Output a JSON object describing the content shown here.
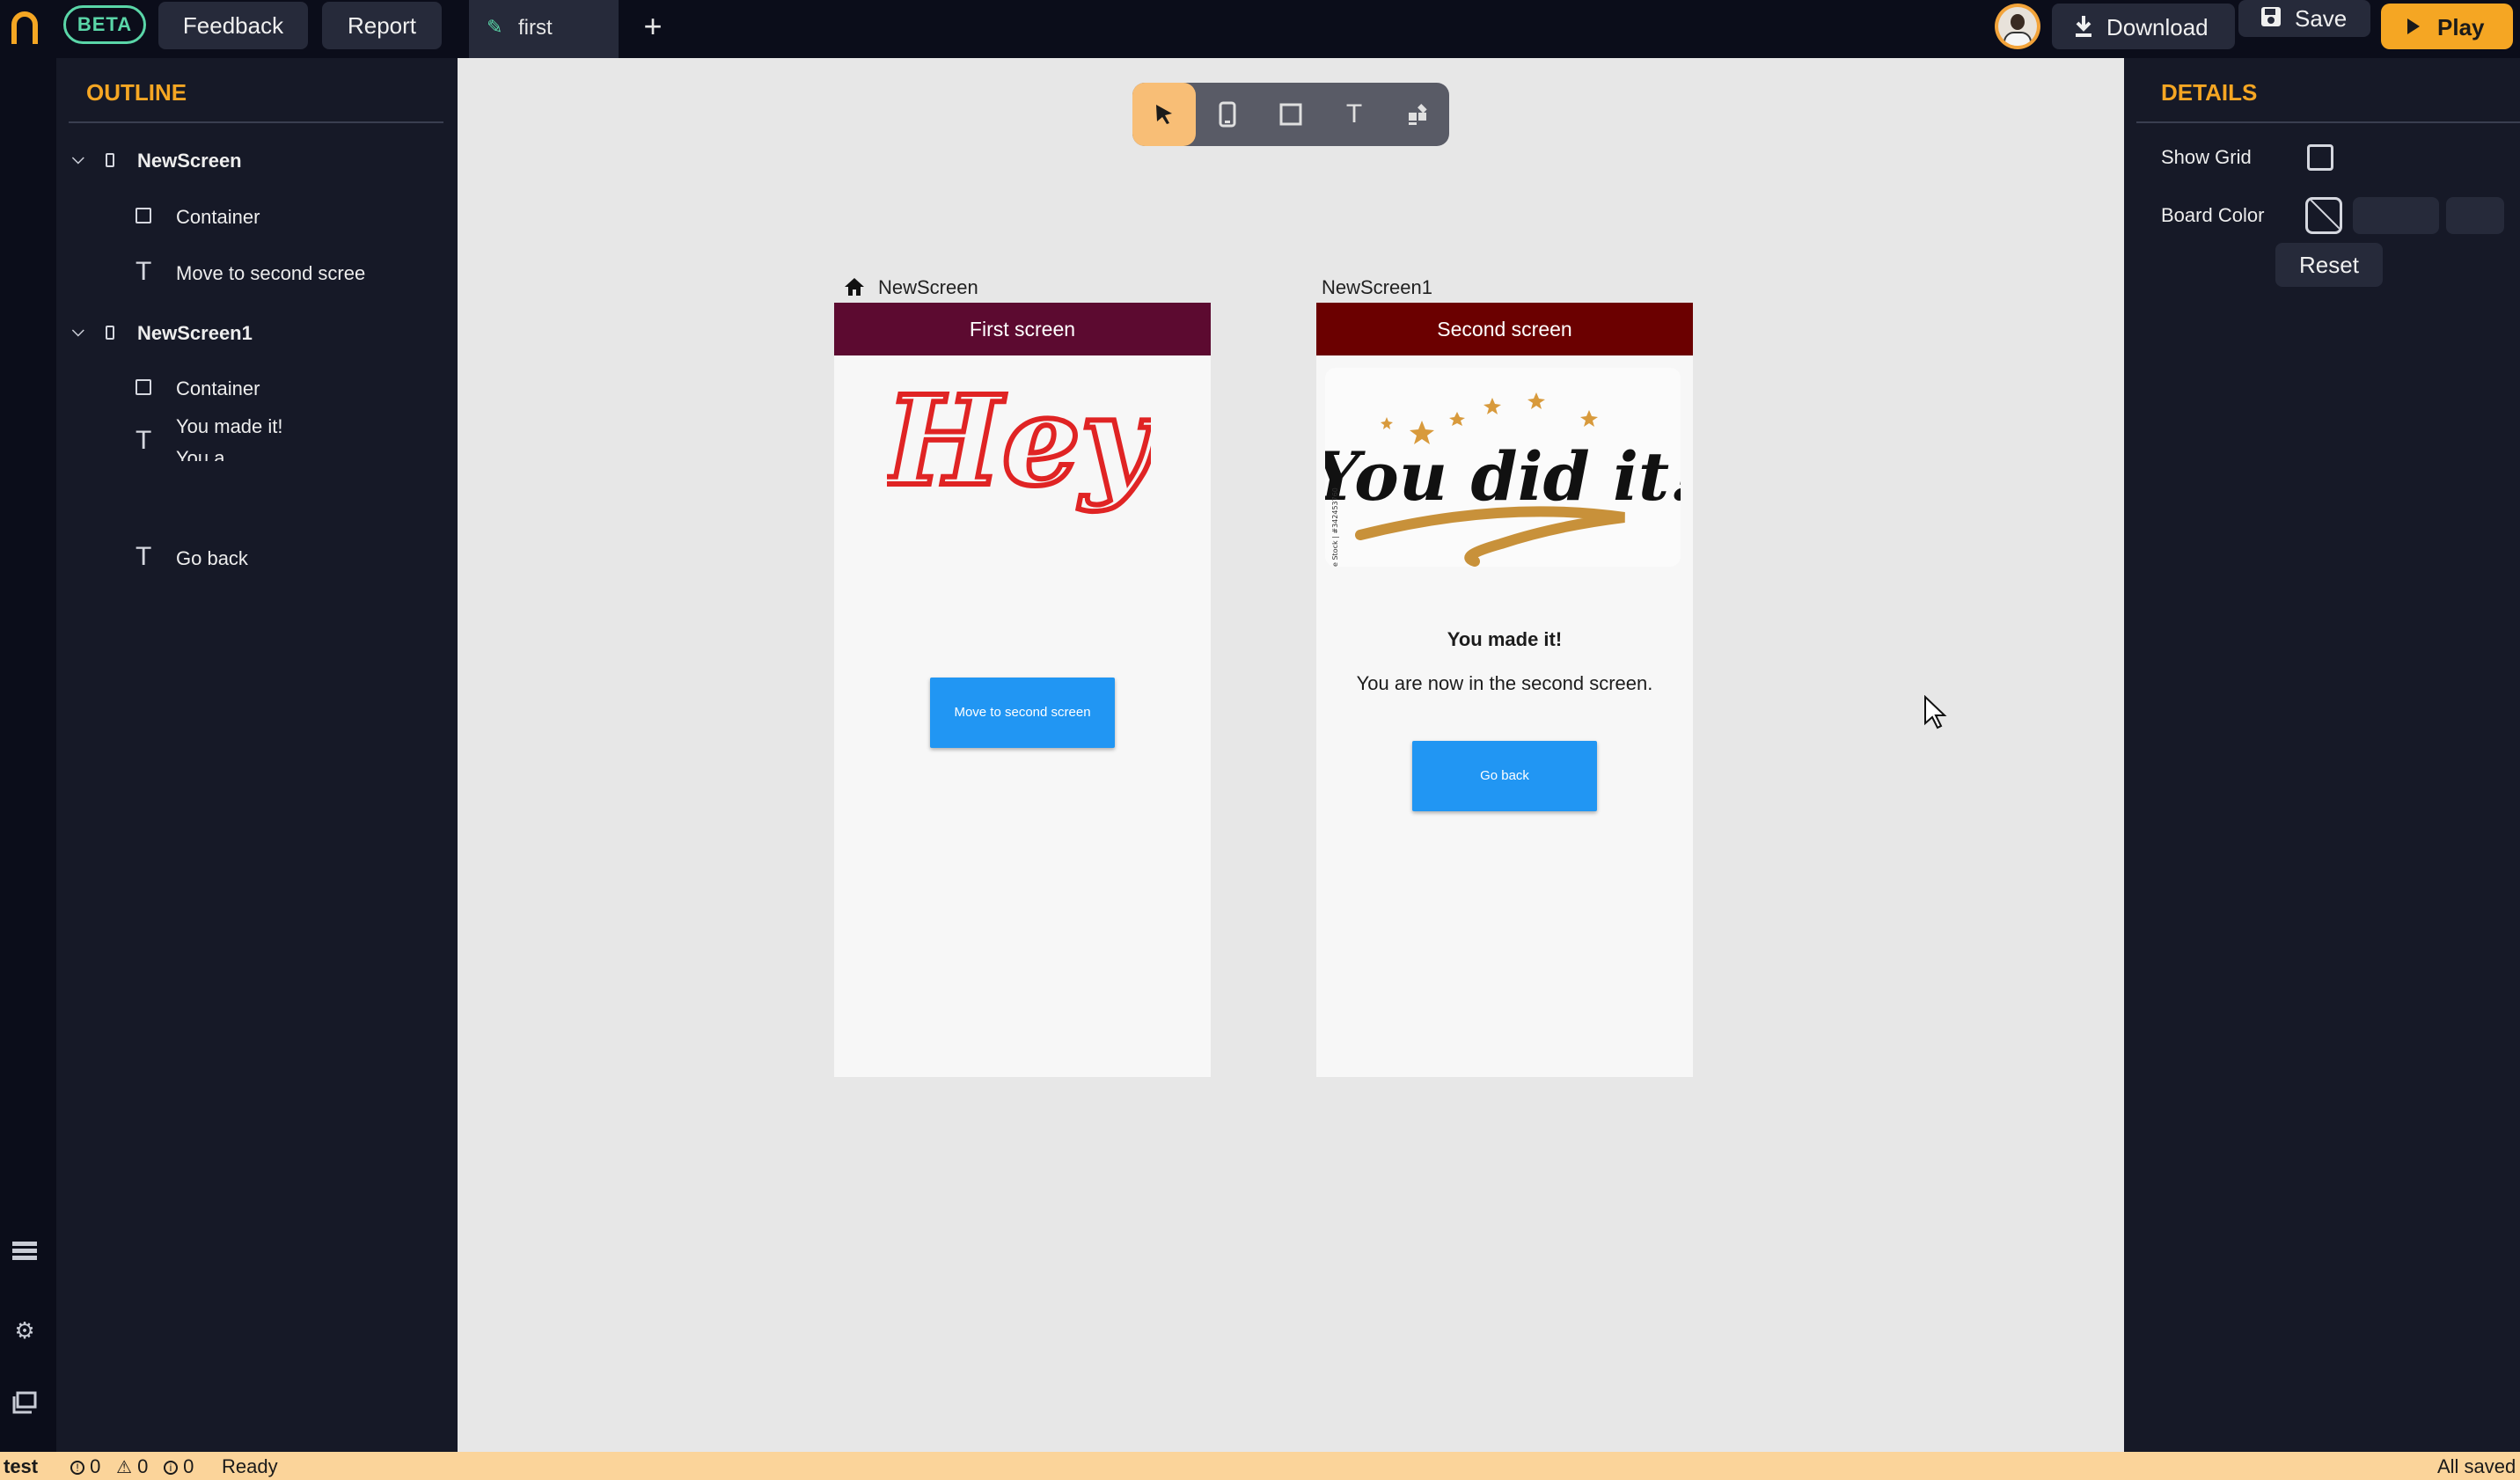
{
  "topbar": {
    "badge": "BETA",
    "feedback": "Feedback",
    "report": "Report",
    "tab_label": "first",
    "download": "Download",
    "save": "Save",
    "play": "Play"
  },
  "outline": {
    "title": "OUTLINE",
    "items": [
      {
        "label": "NewScreen"
      },
      {
        "label": "Container"
      },
      {
        "label": "Move to second scree"
      },
      {
        "label": "NewScreen1"
      },
      {
        "label": "Container"
      },
      {
        "label": "You made it!"
      },
      {
        "label": "You a"
      },
      {
        "label": "Go back"
      }
    ]
  },
  "details": {
    "title": "DETAILS",
    "show_grid": "Show Grid",
    "board_color": "Board Color",
    "reset": "Reset"
  },
  "canvas": {
    "screen1": {
      "name": "NewScreen",
      "appbar": "First screen",
      "appbar_color": "#5c0a30",
      "image_text": "Hey",
      "button": "Move to second screen"
    },
    "screen2": {
      "name": "NewScreen1",
      "appbar": "Second screen",
      "appbar_color": "#6b0000",
      "image_text": "You did it!",
      "image_credit": "e Stock | #342453760",
      "text1": "You made it!",
      "text2": "You are now in the second screen.",
      "button": "Go back"
    }
  },
  "statusbar": {
    "project": "test",
    "errors": "0",
    "warnings": "0",
    "infos": "0",
    "state": "Ready",
    "saved": "All saved"
  },
  "colors": {
    "accent": "#f5a623",
    "beta": "#5ad6a8",
    "button_blue": "#2196f3"
  }
}
